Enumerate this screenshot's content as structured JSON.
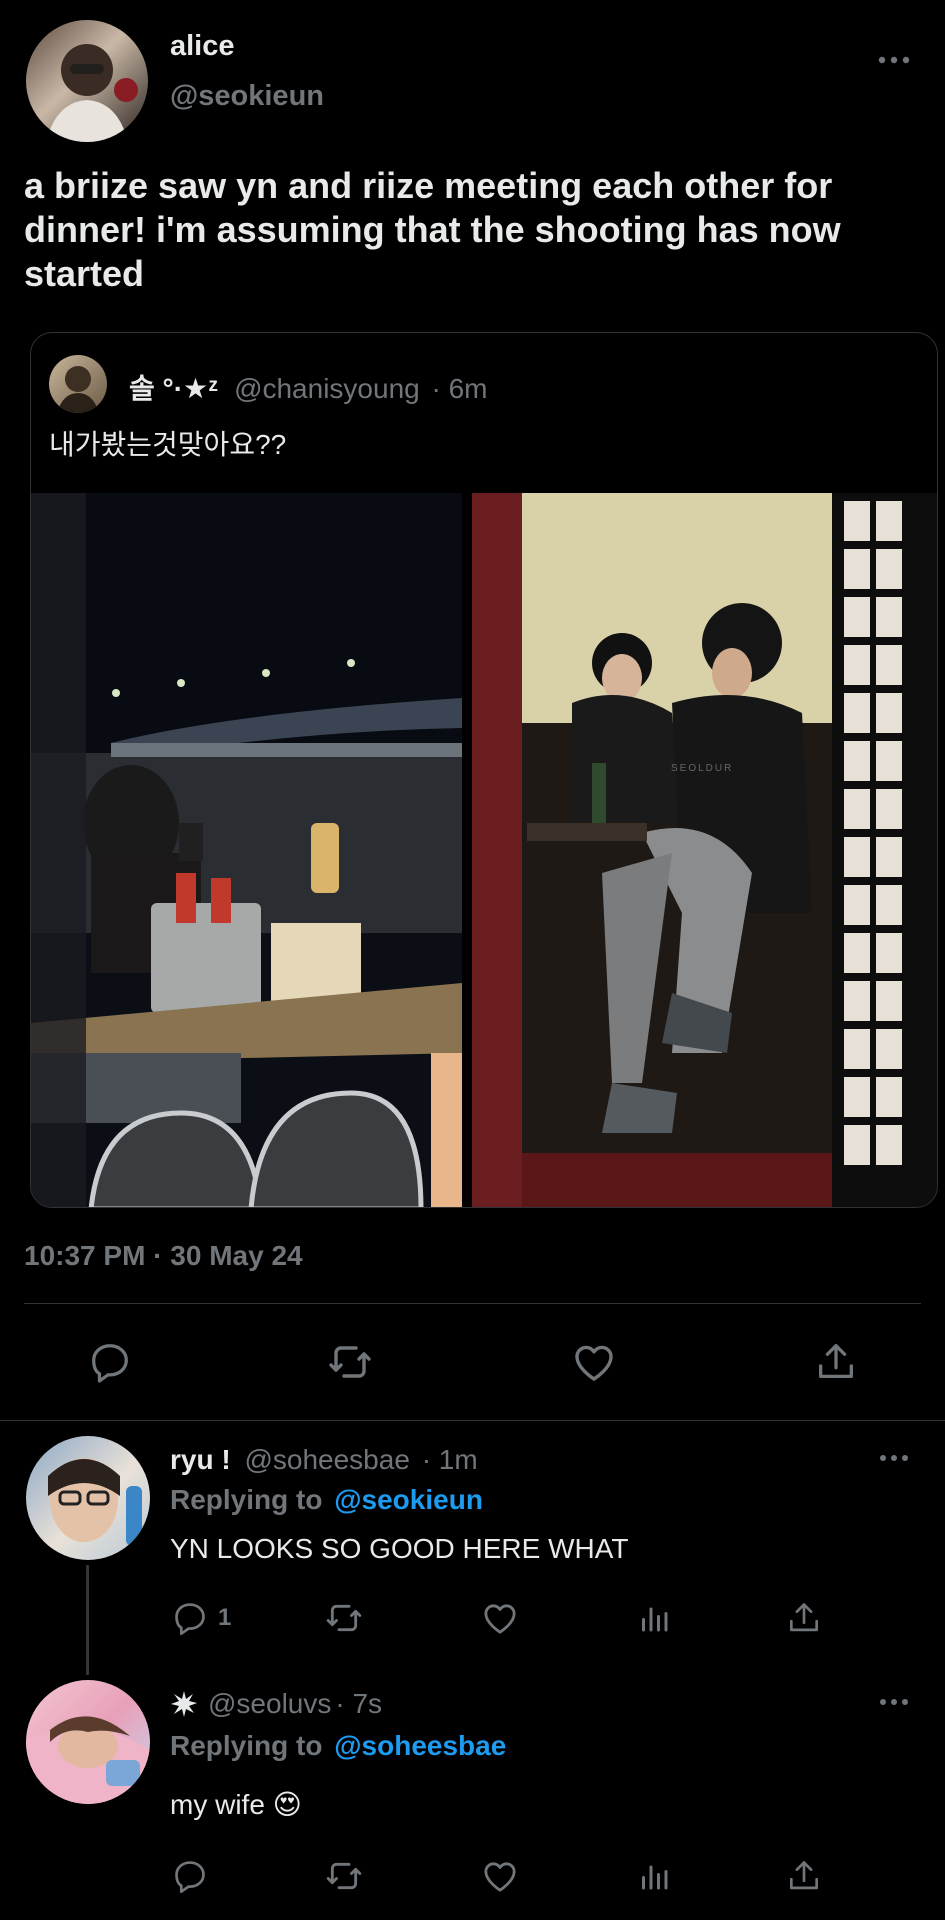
{
  "main_tweet": {
    "author_name": "alice",
    "author_handle": "@seokieun",
    "text": "a briize saw yn and riize meeting each other for dinner! i'm assuming that the shooting has now started",
    "quoted": {
      "author_name": "솔 °·★ᶻ",
      "author_handle": "@chanisyoung",
      "time": "· 6m",
      "text": "내가봤는것맞아요??",
      "watermark": "SEOLDUR"
    },
    "timestamp": "10:37 PM · 30 May 24"
  },
  "replies": [
    {
      "author_name": "ryu !",
      "author_handle": "@soheesbae",
      "time": "· 1m",
      "replying_label": "Replying to",
      "replying_to": "@seokieun",
      "text": "YN LOOKS SO GOOD HERE WHAT",
      "reply_count": "1"
    },
    {
      "author_name": "",
      "author_handle": "@seoluvs",
      "time": "· 7s",
      "replying_label": "Replying to",
      "replying_to": "@soheesbae",
      "text": "my wife 😍",
      "reply_count": ""
    }
  ],
  "icons": [
    "more-icon",
    "reply-icon",
    "retweet-icon",
    "like-icon",
    "share-icon",
    "analytics-icon"
  ],
  "colors": {
    "background": "#000000",
    "text": "#e7e9ea",
    "muted": "#71767b",
    "link": "#1d9bf0",
    "border": "#2f3336"
  }
}
